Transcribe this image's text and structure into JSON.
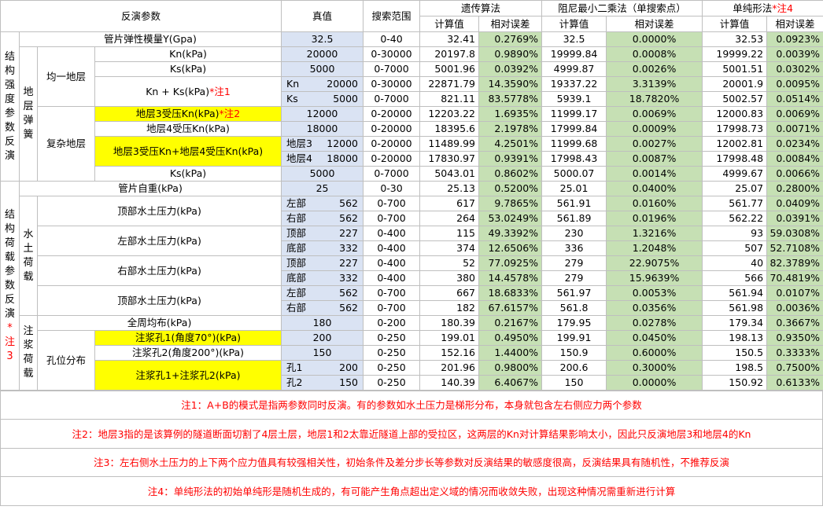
{
  "header": {
    "param": "反演参数",
    "true_value": "真值",
    "range": "搜索范围",
    "ga": "遗传算法",
    "ls": "阻尼最小二乘法（单搜索点）",
    "sp": "单纯形法",
    "sp_note": "*注4",
    "calc": "计算值",
    "err": "相对误差"
  },
  "groups": {
    "structure": "结构强度参数反演",
    "spring": "地层弹簧",
    "uniform": "均一地层",
    "complex": "复杂地层",
    "load": "结构荷载参数反演",
    "load_note": "*注3",
    "soil": "水土荷载",
    "grout": "注浆荷载",
    "hole": "孔位分布"
  },
  "rows": [
    {
      "name": "管片弹性模量Y(Gpa)",
      "tv": "32.5",
      "rg": "0-40",
      "ga": "32.41",
      "gae": "0.2769%",
      "ls": "32.5",
      "lse": "0.0000%",
      "sp": "32.53",
      "spe": "0.0923%"
    },
    {
      "name": "Kn(kPa)",
      "tv": "20000",
      "rg": "0-30000",
      "ga": "20197.8",
      "gae": "0.9890%",
      "ls": "19999.84",
      "lse": "0.0008%",
      "sp": "19999.22",
      "spe": "0.0039%"
    },
    {
      "name": "Ks(kPa)",
      "tv": "5000",
      "rg": "0-7000",
      "ga": "5001.96",
      "gae": "0.0392%",
      "ls": "4999.87",
      "lse": "0.0026%",
      "sp": "5001.51",
      "spe": "0.0302%"
    },
    {
      "name": "Kn + Ks(kPa)",
      "note": "*注1",
      "tvl": "Kn",
      "tv": "20000",
      "rg": "0-30000",
      "ga": "22871.79",
      "gae": "14.3590%",
      "ls": "19337.22",
      "lse": "3.3139%",
      "sp": "20001.9",
      "spe": "0.0095%"
    },
    {
      "tvl": "Ks",
      "tv": "5000",
      "rg": "0-7000",
      "ga": "821.11",
      "gae": "83.5778%",
      "ls": "5939.1",
      "lse": "18.7820%",
      "sp": "5002.57",
      "spe": "0.0514%"
    },
    {
      "name": "地层3受压Kn(kPa)",
      "note": "*注2",
      "tv": "12000",
      "rg": "0-20000",
      "ga": "12203.22",
      "gae": "1.6935%",
      "ls": "11999.17",
      "lse": "0.0069%",
      "sp": "12000.83",
      "spe": "0.0069%"
    },
    {
      "name": "地层4受压Kn(kPa)",
      "tv": "18000",
      "rg": "0-20000",
      "ga": "18395.6",
      "gae": "2.1978%",
      "ls": "17999.84",
      "lse": "0.0009%",
      "sp": "17998.73",
      "spe": "0.0071%"
    },
    {
      "name": "地层3受压Kn+地层4受压Kn(kPa)",
      "tvl": "地层3",
      "tv": "12000",
      "rg": "0-20000",
      "ga": "11489.99",
      "gae": "4.2501%",
      "ls": "11999.68",
      "lse": "0.0027%",
      "sp": "12002.81",
      "spe": "0.0234%"
    },
    {
      "tvl": "地层4",
      "tv": "18000",
      "rg": "0-20000",
      "ga": "17830.97",
      "gae": "0.9391%",
      "ls": "17998.43",
      "lse": "0.0087%",
      "sp": "17998.48",
      "spe": "0.0084%"
    },
    {
      "name": "Ks(kPa)",
      "tv": "5000",
      "rg": "0-7000",
      "ga": "5043.01",
      "gae": "0.8602%",
      "ls": "5000.07",
      "lse": "0.0014%",
      "sp": "4999.67",
      "spe": "0.0066%"
    },
    {
      "name": "管片自重(kPa)",
      "tv": "25",
      "rg": "0-30",
      "ga": "25.13",
      "gae": "0.5200%",
      "ls": "25.01",
      "lse": "0.0400%",
      "sp": "25.07",
      "spe": "0.2800%"
    },
    {
      "name": "顶部水土压力(kPa)",
      "tvl": "左部",
      "tv": "562",
      "rg": "0-700",
      "ga": "617",
      "gae": "9.7865%",
      "ls": "561.91",
      "lse": "0.0160%",
      "sp": "561.77",
      "spe": "0.0409%"
    },
    {
      "tvl": "右部",
      "tv": "562",
      "rg": "0-700",
      "ga": "264",
      "gae": "53.0249%",
      "ls": "561.89",
      "lse": "0.0196%",
      "sp": "562.22",
      "spe": "0.0391%"
    },
    {
      "name": "左部水土压力(kPa)",
      "tvl": "顶部",
      "tv": "227",
      "rg": "0-400",
      "ga": "115",
      "gae": "49.3392%",
      "ls": "230",
      "lse": "1.3216%",
      "sp": "93",
      "spe": "59.0308%"
    },
    {
      "tvl": "底部",
      "tv": "332",
      "rg": "0-400",
      "ga": "374",
      "gae": "12.6506%",
      "ls": "336",
      "lse": "1.2048%",
      "sp": "507",
      "spe": "52.7108%"
    },
    {
      "name": "右部水土压力(kPa)",
      "tvl": "顶部",
      "tv": "227",
      "rg": "0-400",
      "ga": "52",
      "gae": "77.0925%",
      "ls": "279",
      "lse": "22.9075%",
      "sp": "40",
      "spe": "82.3789%"
    },
    {
      "tvl": "底部",
      "tv": "332",
      "rg": "0-400",
      "ga": "380",
      "gae": "14.4578%",
      "ls": "279",
      "lse": "15.9639%",
      "sp": "566",
      "spe": "70.4819%"
    },
    {
      "name": "顶部水土压力(kPa)",
      "tvl": "左部",
      "tv": "562",
      "rg": "0-700",
      "ga": "667",
      "gae": "18.6833%",
      "ls": "561.97",
      "lse": "0.0053%",
      "sp": "561.94",
      "spe": "0.0107%"
    },
    {
      "tvl": "右部",
      "tv": "562",
      "rg": "0-700",
      "ga": "182",
      "gae": "67.6157%",
      "ls": "561.8",
      "lse": "0.0356%",
      "sp": "561.98",
      "spe": "0.0036%"
    },
    {
      "name": "全周均布(kPa)",
      "tv": "180",
      "rg": "0-200",
      "ga": "180.39",
      "gae": "0.2167%",
      "ls": "179.95",
      "lse": "0.0278%",
      "sp": "179.34",
      "spe": "0.3667%"
    },
    {
      "name": "注浆孔1(角度70°)(kPa)",
      "tv": "200",
      "rg": "0-250",
      "ga": "199.01",
      "gae": "0.4950%",
      "ls": "199.91",
      "lse": "0.0450%",
      "sp": "198.13",
      "spe": "0.9350%"
    },
    {
      "name": "注浆孔2(角度200°)(kPa)",
      "tv": "150",
      "rg": "0-250",
      "ga": "152.16",
      "gae": "1.4400%",
      "ls": "150.9",
      "lse": "0.6000%",
      "sp": "150.5",
      "spe": "0.3333%"
    },
    {
      "name": "注浆孔1+注浆孔2(kPa)",
      "tvl": "孔1",
      "tv": "200",
      "rg": "0-250",
      "ga": "201.96",
      "gae": "0.9800%",
      "ls": "200.6",
      "lse": "0.3000%",
      "sp": "198.5",
      "spe": "0.7500%"
    },
    {
      "tvl": "孔2",
      "tv": "150",
      "rg": "0-250",
      "ga": "140.39",
      "gae": "6.4067%",
      "ls": "150",
      "lse": "0.0000%",
      "sp": "150.92",
      "spe": "0.6133%"
    }
  ],
  "notes": [
    "注1：A+B的模式是指两参数同时反演。有的参数如水土压力是梯形分布，本身就包含左右侧应力两个参数",
    "注2：地层3指的是该算例的隧道断面切割了4层土层，地层1和2太靠近隧道上部的受拉区，这两层的Kn对计算结果影响太小，因此只反演地层3和地层4的Kn",
    "注3：左右侧水土压力的上下两个应力值具有较强相关性，初始条件及差分步长等参数对反演结果的敏感度很高，反演结果具有随机性，不推荐反演",
    "注4：单纯形法的初始单纯形是随机生成的，有可能产生角点超出定义域的情况而收敛失败，出现这种情况需重新进行计算"
  ]
}
